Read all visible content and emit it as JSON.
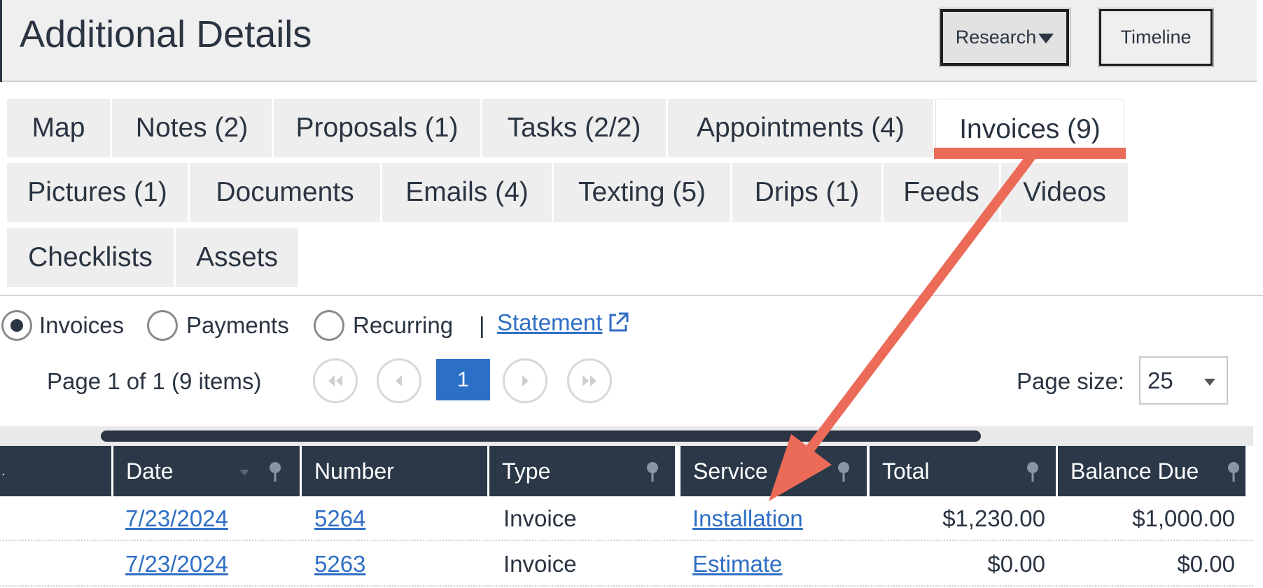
{
  "header": {
    "title": "Additional Details",
    "research_label": "Research",
    "timeline_label": "Timeline"
  },
  "tabs": [
    {
      "label": "Map"
    },
    {
      "label": "Notes (2)"
    },
    {
      "label": "Proposals (1)"
    },
    {
      "label": "Tasks (2/2)"
    },
    {
      "label": "Appointments (4)"
    },
    {
      "label": "Invoices (9)",
      "active": true
    },
    {
      "label": "Pictures (1)"
    },
    {
      "label": "Documents"
    },
    {
      "label": "Emails (4)"
    },
    {
      "label": "Texting (5)"
    },
    {
      "label": "Drips (1)"
    },
    {
      "label": "Feeds"
    },
    {
      "label": "Videos"
    },
    {
      "label": "Checklists"
    },
    {
      "label": "Assets"
    }
  ],
  "filters": {
    "options": [
      {
        "label": "Invoices",
        "checked": true
      },
      {
        "label": "Payments",
        "checked": false
      },
      {
        "label": "Recurring",
        "checked": false
      }
    ],
    "separator": "|",
    "statement_link": "Statement"
  },
  "pager": {
    "info": "Page 1 of 1 (9 items)",
    "current_page": "1",
    "page_size_label": "Page size:",
    "page_size": "25"
  },
  "grid": {
    "columns": [
      "Date",
      "Number",
      "Type",
      "Service",
      "Total",
      "Balance Due"
    ],
    "rows": [
      {
        "date": "7/23/2024",
        "number": "5264",
        "type": "Invoice",
        "service": "Installation",
        "total": "$1,230.00",
        "balance": "$1,000.00"
      },
      {
        "date": "7/23/2024",
        "number": "5263",
        "type": "Invoice",
        "service": "Estimate",
        "total": "$0.00",
        "balance": "$0.00"
      }
    ]
  },
  "colors": {
    "accent": "#2b6fc7",
    "header_dark": "#2a3847",
    "annotation": "#ec6b58",
    "link": "#2f6fc4"
  }
}
